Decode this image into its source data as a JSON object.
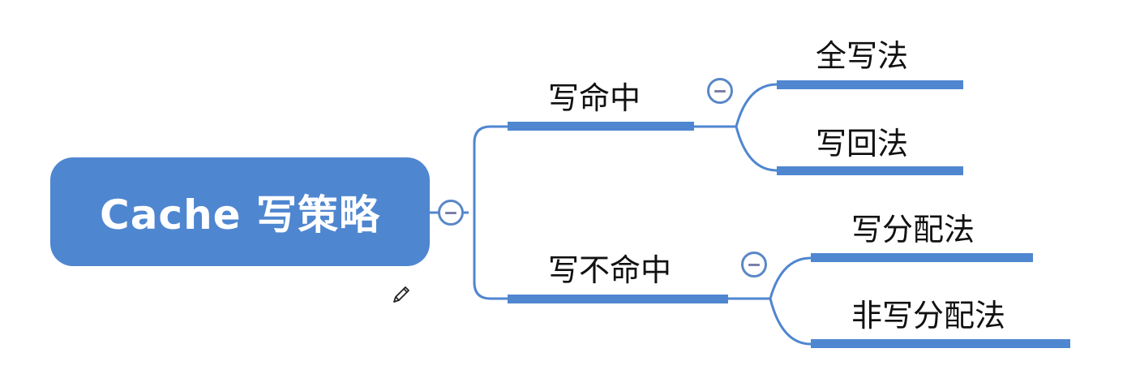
{
  "colors": {
    "accent": "#4f86d0",
    "line": "#4f86d0",
    "text": "#111111",
    "root_text": "#ffffff"
  },
  "root": {
    "label": "Cache 写策略"
  },
  "branches": [
    {
      "label": "写命中",
      "children": [
        {
          "label": "全写法"
        },
        {
          "label": "写回法"
        }
      ]
    },
    {
      "label": "写不命中",
      "children": [
        {
          "label": "写分配法"
        },
        {
          "label": "非写分配法"
        }
      ]
    }
  ],
  "icons": {
    "collapse": "minus-circle-icon",
    "edit": "pencil-icon"
  }
}
